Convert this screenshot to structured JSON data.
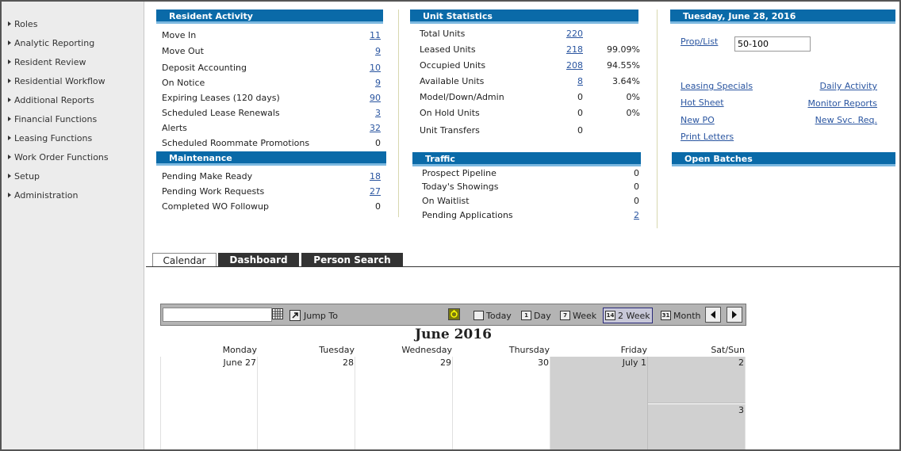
{
  "sidebar": {
    "items": [
      {
        "label": "Roles"
      },
      {
        "label": "Analytic Reporting"
      },
      {
        "label": "Resident Review"
      },
      {
        "label": "Residential Workflow"
      },
      {
        "label": "Additional Reports"
      },
      {
        "label": "Financial Functions"
      },
      {
        "label": "Leasing Functions"
      },
      {
        "label": "Work Order Functions"
      },
      {
        "label": "Setup"
      },
      {
        "label": "Administration"
      }
    ]
  },
  "resident_activity": {
    "title": "Resident Activity",
    "rows": [
      {
        "label": "Move In",
        "value": "11"
      },
      {
        "label": "Move Out",
        "value": "9"
      },
      {
        "label": "Deposit Accounting",
        "value": "10"
      },
      {
        "label": "On Notice",
        "value": "9"
      },
      {
        "label": "Expiring Leases (120 days)",
        "value": "90"
      },
      {
        "label": "Scheduled Lease Renewals",
        "value": "3"
      },
      {
        "label": "Alerts",
        "value": "32"
      },
      {
        "label": "Scheduled Roommate Promotions",
        "value": "0"
      }
    ]
  },
  "maintenance": {
    "title": "Maintenance",
    "rows": [
      {
        "label": "Pending Make Ready",
        "value": "18"
      },
      {
        "label": "Pending Work Requests",
        "value": "27"
      },
      {
        "label": "Completed WO Followup",
        "value": "0"
      }
    ]
  },
  "unit_statistics": {
    "title": "Unit Statistics",
    "rows": [
      {
        "label": "Total Units",
        "value": "220",
        "pct": ""
      },
      {
        "label": "Leased Units",
        "value": "218",
        "pct": "99.09%"
      },
      {
        "label": "Occupied Units",
        "value": "208",
        "pct": "94.55%"
      },
      {
        "label": "Available Units",
        "value": "8",
        "pct": "3.64%"
      },
      {
        "label": "Model/Down/Admin",
        "value": "0",
        "pct": "0%"
      },
      {
        "label": "On Hold Units",
        "value": "0",
        "pct": "0%"
      },
      {
        "label": "Unit Transfers",
        "value": "0",
        "pct": ""
      }
    ]
  },
  "traffic": {
    "title": "Traffic",
    "rows": [
      {
        "label": "Prospect Pipeline",
        "value": "0"
      },
      {
        "label": "Today's Showings",
        "value": "0"
      },
      {
        "label": "On Waitlist",
        "value": "0"
      },
      {
        "label": "Pending Applications",
        "value": "2"
      }
    ]
  },
  "date_panel": {
    "title": "Tuesday, June 28, 2016",
    "prop_list_label": "Prop/List",
    "prop_list_value": "50-100",
    "links_left": [
      "Leasing Specials",
      "Hot Sheet",
      "New PO",
      "Print Letters"
    ],
    "links_right": [
      "Daily Activity",
      "Monitor Reports",
      "New Svc. Req."
    ]
  },
  "open_batches": {
    "title": "Open Batches"
  },
  "tabs": [
    {
      "label": "Calendar"
    },
    {
      "label": "Dashboard"
    },
    {
      "label": "Person Search"
    }
  ],
  "calendar": {
    "jump_to": "Jump To",
    "today": "Today",
    "day": "Day",
    "week": "Week",
    "two_week": "2 Week",
    "month": "Month",
    "title": "June 2016",
    "day_names": [
      "Monday",
      "Tuesday",
      "Wednesday",
      "Thursday",
      "Friday",
      "Sat/Sun"
    ],
    "day_numbers": [
      "June 27",
      "28",
      "29",
      "30",
      "July 1",
      "2",
      "3"
    ]
  }
}
